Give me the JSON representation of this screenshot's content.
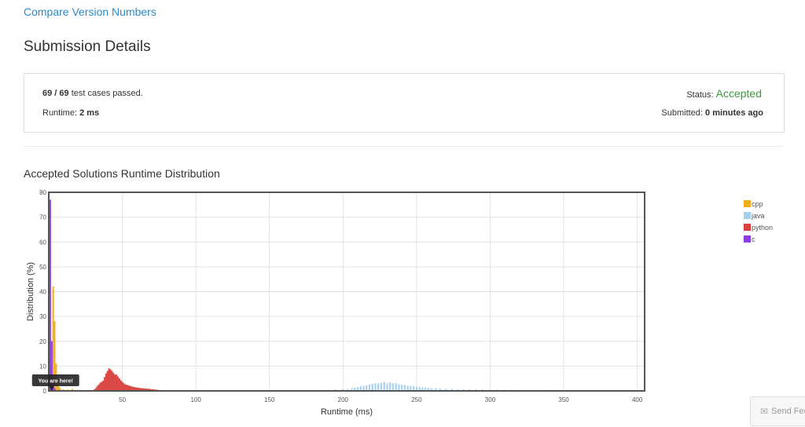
{
  "problem": {
    "title": "Compare Version Numbers"
  },
  "page": {
    "heading": "Submission Details"
  },
  "summary": {
    "passed": "69 / 69",
    "passed_suffix": " test cases passed.",
    "runtime_label": "Runtime: ",
    "runtime_value": "2 ms",
    "status_label": "Status: ",
    "status_value": "Accepted",
    "submitted_label": "Submitted: ",
    "submitted_value": "0 minutes ago"
  },
  "chart_section": {
    "title": "Accepted Solutions Runtime Distribution"
  },
  "feedback": {
    "label": "Send Feedback",
    "icon": "envelope-icon"
  },
  "chart_data": {
    "type": "bar",
    "xlabel": "Runtime (ms)",
    "ylabel": "Distribution (%)",
    "xlim": [
      0,
      405
    ],
    "ylim": [
      0,
      80
    ],
    "xticks": [
      50,
      100,
      150,
      200,
      250,
      300,
      350,
      400
    ],
    "yticks": [
      0,
      10,
      20,
      30,
      40,
      50,
      60,
      70,
      80
    ],
    "grid": true,
    "legend_position": "right",
    "annotation": {
      "text": "You are here!",
      "x": 2
    },
    "series": [
      {
        "name": "cpp",
        "color": "#f0ad1e",
        "bin": 1,
        "points": [
          [
            3,
            42
          ],
          [
            4,
            28
          ],
          [
            5,
            11
          ],
          [
            6,
            3
          ],
          [
            7,
            1.5
          ],
          [
            8,
            0.8
          ],
          [
            10,
            0.6
          ],
          [
            13,
            0.5
          ],
          [
            16,
            0.8
          ],
          [
            20,
            0.3
          ]
        ]
      },
      {
        "name": "java",
        "color": "#a6cfee",
        "bin": 1,
        "points": [
          [
            185,
            0.3
          ],
          [
            190,
            0.4
          ],
          [
            195,
            0.5
          ],
          [
            200,
            0.6
          ],
          [
            203,
            0.7
          ],
          [
            206,
            1.0
          ],
          [
            208,
            1.2
          ],
          [
            210,
            1.5
          ],
          [
            212,
            1.8
          ],
          [
            214,
            2.0
          ],
          [
            216,
            2.2
          ],
          [
            218,
            2.5
          ],
          [
            220,
            2.8
          ],
          [
            222,
            3.0
          ],
          [
            224,
            3.0
          ],
          [
            226,
            3.2
          ],
          [
            228,
            3.6
          ],
          [
            230,
            3.0
          ],
          [
            232,
            3.4
          ],
          [
            234,
            3.0
          ],
          [
            236,
            3.0
          ],
          [
            238,
            2.6
          ],
          [
            240,
            2.4
          ],
          [
            242,
            2.3
          ],
          [
            244,
            2.0
          ],
          [
            246,
            2.0
          ],
          [
            248,
            1.8
          ],
          [
            250,
            1.6
          ],
          [
            252,
            1.5
          ],
          [
            254,
            1.4
          ],
          [
            256,
            1.3
          ],
          [
            258,
            1.2
          ],
          [
            260,
            1.1
          ],
          [
            263,
            1.0
          ],
          [
            266,
            0.9
          ],
          [
            270,
            0.8
          ],
          [
            274,
            0.7
          ],
          [
            278,
            0.6
          ],
          [
            282,
            0.6
          ],
          [
            286,
            0.5
          ],
          [
            290,
            0.5
          ],
          [
            295,
            0.5
          ],
          [
            300,
            0.4
          ],
          [
            305,
            0.4
          ],
          [
            310,
            0.4
          ],
          [
            316,
            0.3
          ],
          [
            322,
            0.3
          ],
          [
            328,
            0.3
          ],
          [
            335,
            0.3
          ],
          [
            342,
            0.3
          ],
          [
            350,
            0.3
          ],
          [
            358,
            0.2
          ],
          [
            366,
            0.2
          ],
          [
            374,
            0.2
          ],
          [
            382,
            0.2
          ],
          [
            390,
            0.2
          ],
          [
            398,
            0.2
          ]
        ]
      },
      {
        "name": "python",
        "color": "#d9403d",
        "bin": 1,
        "points": [
          [
            31,
            0.5
          ],
          [
            32,
            1.0
          ],
          [
            33,
            1.8
          ],
          [
            34,
            2.5
          ],
          [
            35,
            3.2
          ],
          [
            36,
            3.6
          ],
          [
            37,
            4.0
          ],
          [
            38,
            5.5
          ],
          [
            39,
            7.0
          ],
          [
            40,
            8.0
          ],
          [
            41,
            9.0
          ],
          [
            42,
            8.6
          ],
          [
            43,
            8.0
          ],
          [
            44,
            7.2
          ],
          [
            45,
            6.5
          ],
          [
            46,
            6.5
          ],
          [
            47,
            5.8
          ],
          [
            48,
            5.0
          ],
          [
            49,
            4.2
          ],
          [
            50,
            3.5
          ],
          [
            51,
            3.0
          ],
          [
            52,
            2.6
          ],
          [
            53,
            2.4
          ],
          [
            54,
            2.2
          ],
          [
            55,
            2.0
          ],
          [
            56,
            1.8
          ],
          [
            57,
            1.6
          ],
          [
            58,
            1.5
          ],
          [
            59,
            1.4
          ],
          [
            60,
            1.3
          ],
          [
            61,
            1.2
          ],
          [
            62,
            1.1
          ],
          [
            63,
            1.0
          ],
          [
            64,
            1.0
          ],
          [
            65,
            0.9
          ],
          [
            66,
            0.9
          ],
          [
            67,
            0.8
          ],
          [
            68,
            0.8
          ],
          [
            69,
            0.7
          ],
          [
            70,
            0.6
          ],
          [
            71,
            0.6
          ],
          [
            72,
            0.5
          ],
          [
            73,
            0.4
          ],
          [
            74,
            0.4
          ]
        ]
      },
      {
        "name": "c",
        "color": "#8d3de6",
        "bin": 1,
        "points": [
          [
            1,
            77
          ],
          [
            2,
            20
          ],
          [
            3,
            3
          ],
          [
            4,
            1
          ]
        ]
      }
    ]
  }
}
